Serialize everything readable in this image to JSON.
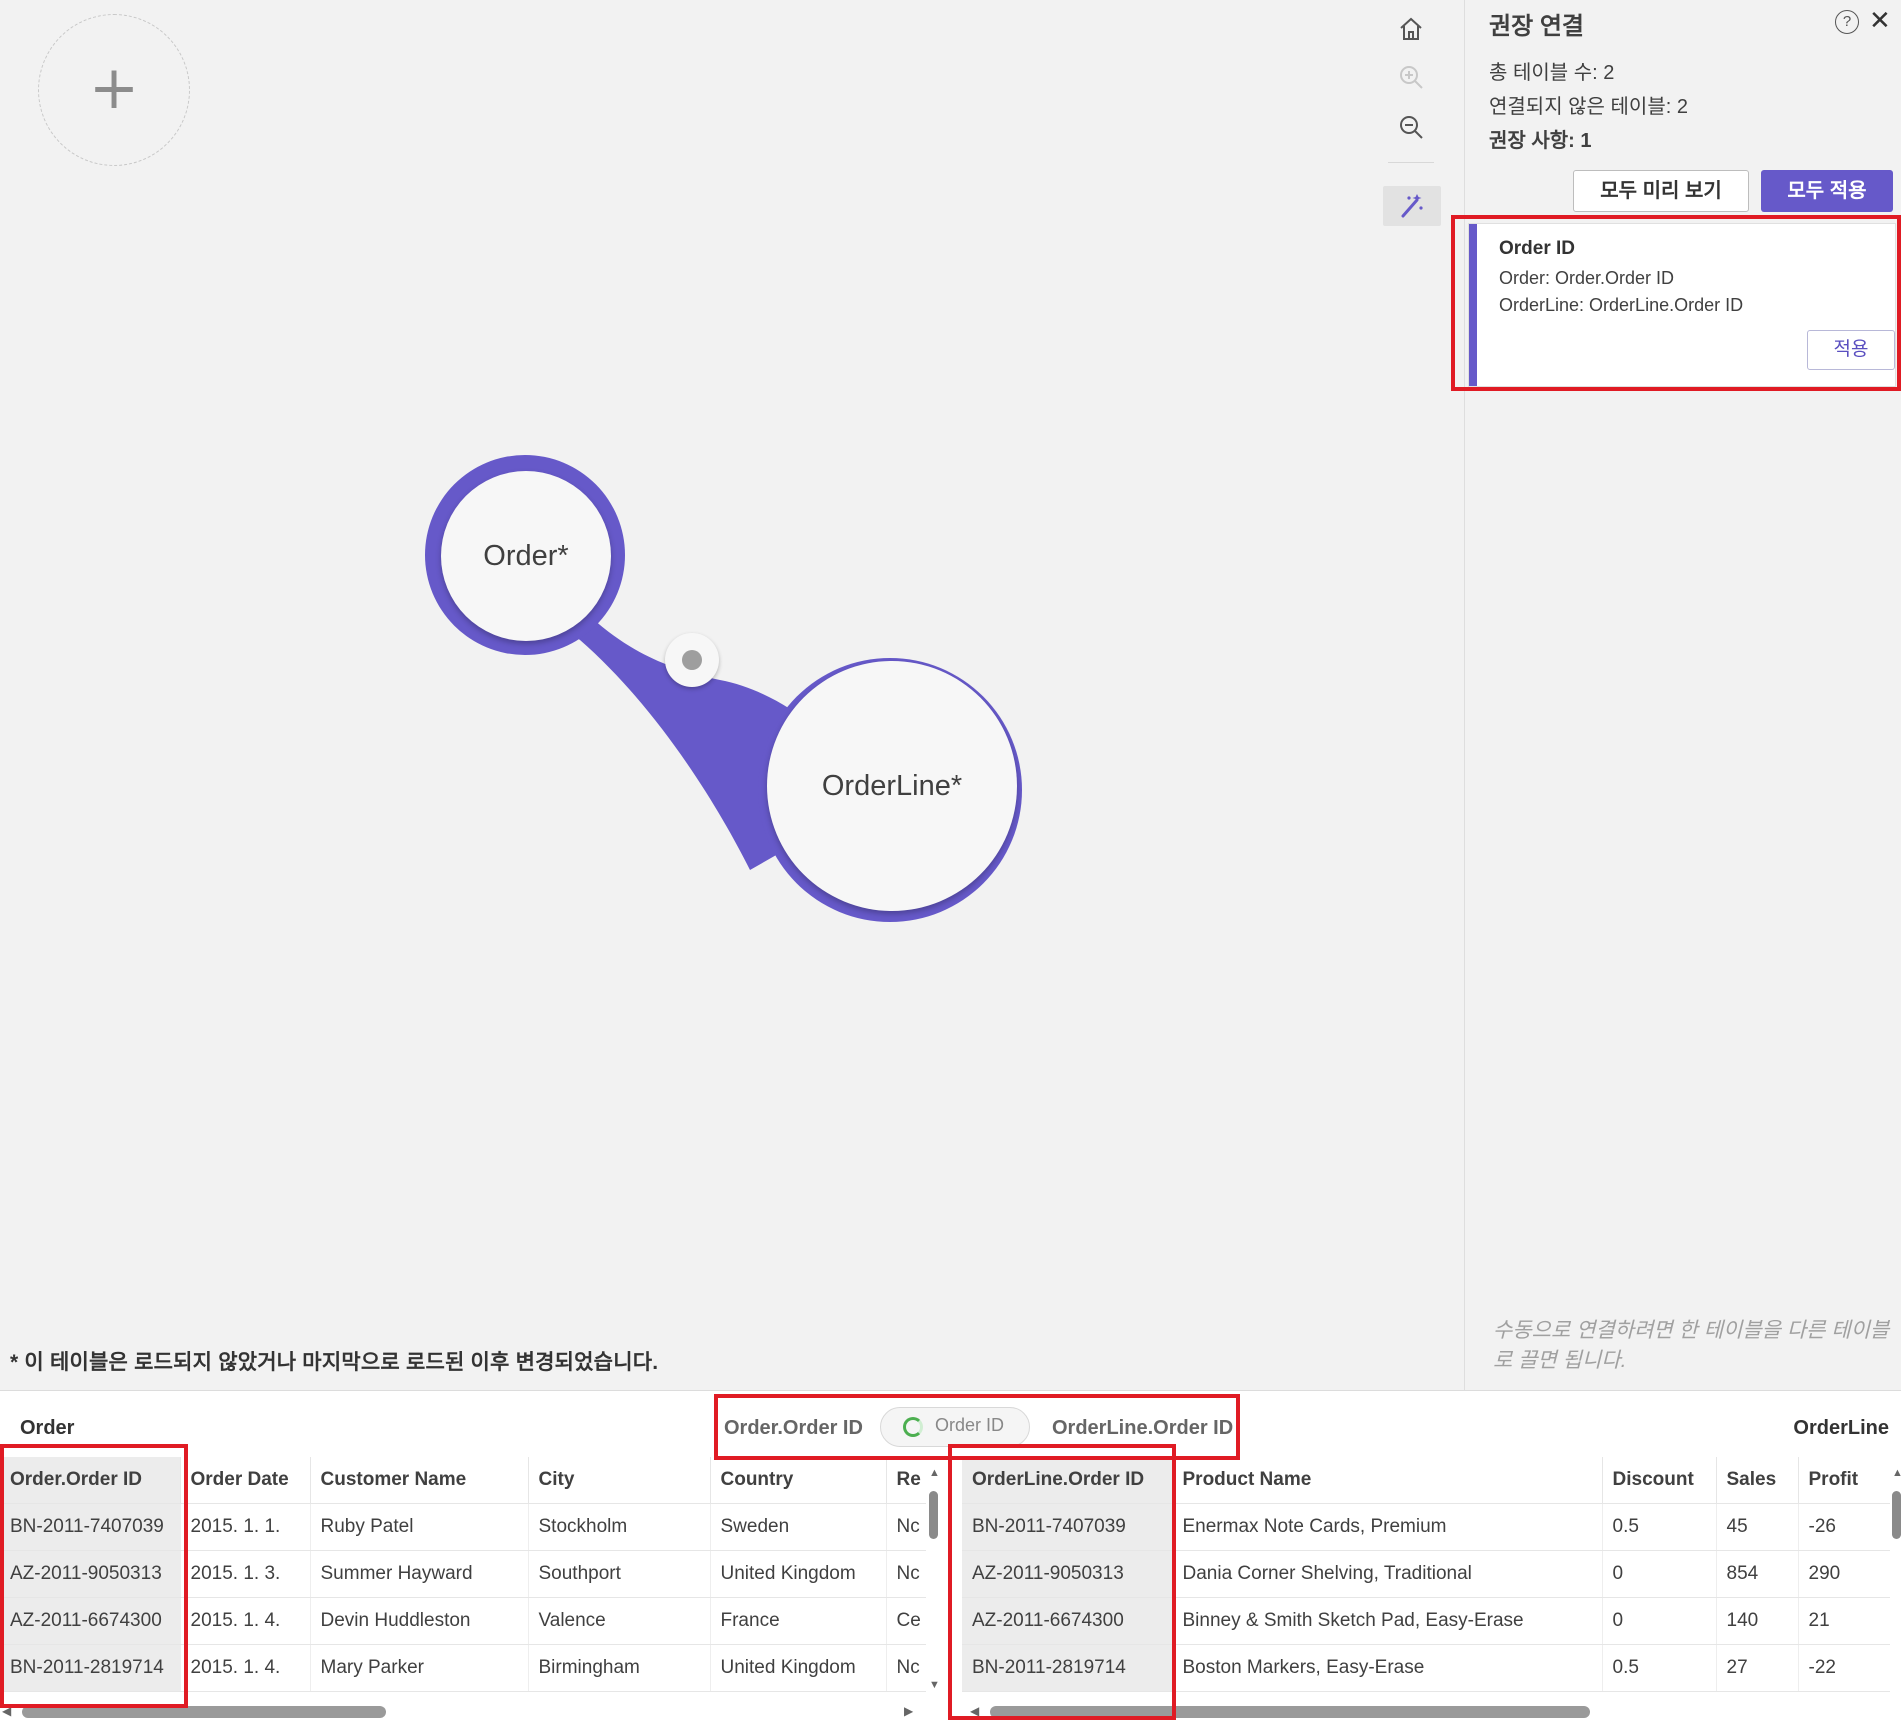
{
  "canvas": {
    "add_button": "+",
    "tools": [
      {
        "icon": "home-icon"
      },
      {
        "icon": "zoom-in-icon"
      },
      {
        "icon": "zoom-out-icon"
      },
      {
        "icon": "magic-wand-icon"
      }
    ],
    "nodes": [
      {
        "label": "Order*"
      },
      {
        "label": "OrderLine*"
      }
    ],
    "footnote": "* 이 테이블은 로드되지 않았거나 마지막으로 로드된 이후 변경되었습니다."
  },
  "panel": {
    "title": "권장 연결",
    "help_icon": "?",
    "close_icon": "✕",
    "stats": {
      "total_tables": "총 테이블 수: 2",
      "unlinked_tables": "연결되지 않은 테이블: 2",
      "recommendations": "권장 사항: 1"
    },
    "preview_all": "모두 미리 보기",
    "apply_all": "모두 적용",
    "card": {
      "title": "Order ID",
      "line1": "Order: Order.Order ID",
      "line2": "OrderLine: OrderLine.Order ID",
      "apply": "적용"
    },
    "hint": "수동으로 연결하려면 한 테이블을 다른 테이블로 끌면 됩니다."
  },
  "bottom": {
    "left_table_name": "Order",
    "right_table_name": "OrderLine",
    "assoc_left": "Order.Order ID",
    "assoc_mid": "Order ID",
    "assoc_right": "OrderLine.Order ID",
    "left_table": {
      "headers": [
        "Order.Order ID",
        "Order Date",
        "Customer Name",
        "City",
        "Country",
        "Re"
      ],
      "rows": [
        [
          "BN-2011-7407039",
          "2015. 1. 1.",
          "Ruby Patel",
          "Stockholm",
          "Sweden",
          "Nc"
        ],
        [
          "AZ-2011-9050313",
          "2015. 1. 3.",
          "Summer Hayward",
          "Southport",
          "United Kingdom",
          "Nc"
        ],
        [
          "AZ-2011-6674300",
          "2015. 1. 4.",
          "Devin Huddleston",
          "Valence",
          "France",
          "Ce"
        ],
        [
          "BN-2011-2819714",
          "2015. 1. 4.",
          "Mary Parker",
          "Birmingham",
          "United Kingdom",
          "Nc"
        ]
      ]
    },
    "right_table": {
      "headers": [
        "OrderLine.Order ID",
        "Product Name",
        "Discount",
        "Sales",
        "Profit"
      ],
      "rows": [
        [
          "BN-2011-7407039",
          "Enermax Note Cards, Premium",
          "0.5",
          "45",
          "-26"
        ],
        [
          "AZ-2011-9050313",
          "Dania Corner Shelving, Traditional",
          "0",
          "854",
          "290"
        ],
        [
          "AZ-2011-6674300",
          "Binney & Smith Sketch Pad, Easy-Erase",
          "0",
          "140",
          "21"
        ],
        [
          "BN-2011-2819714",
          "Boston Markers, Easy-Erase",
          "0.5",
          "27",
          "-22"
        ]
      ]
    }
  },
  "colors": {
    "accent": "#6659c9",
    "highlight": "#e01b24"
  }
}
